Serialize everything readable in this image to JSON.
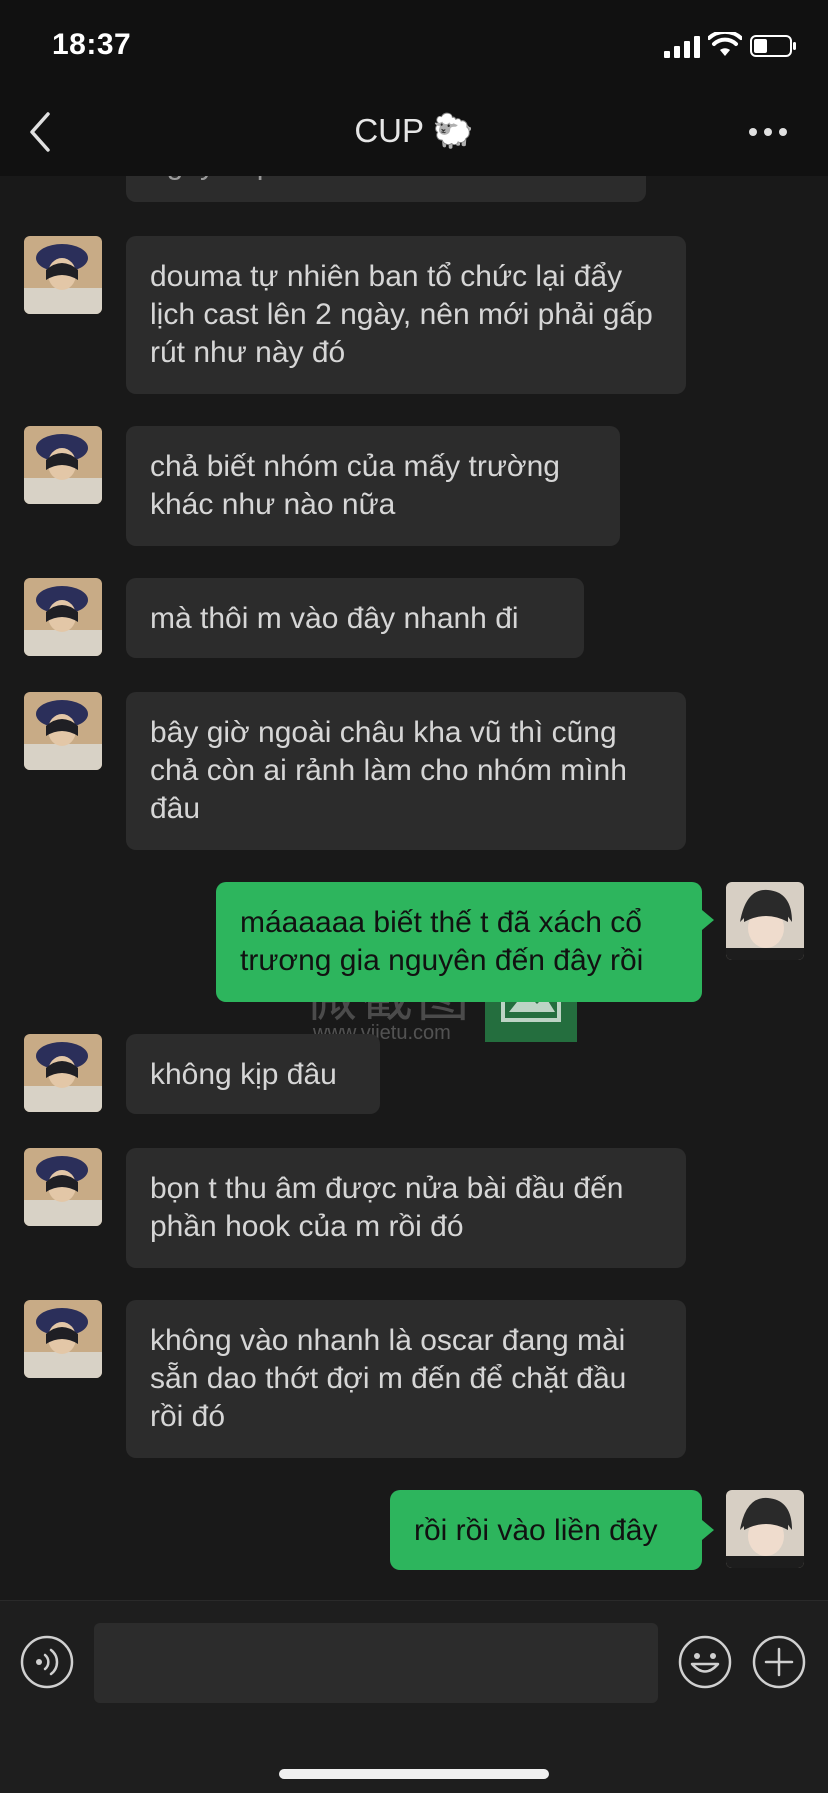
{
  "status_bar": {
    "time": "18:37"
  },
  "header": {
    "title": "CUP 🐑"
  },
  "messages": [
    {
      "from": "other",
      "text": "ngày ... p"
    },
    {
      "from": "other",
      "text": "douma tự nhiên ban tổ chức lại đẩy lịch cast lên 2 ngày, nên mới phải gấp rút như này đó"
    },
    {
      "from": "other",
      "text": "chả biết nhóm của mấy trường khác như nào nữa"
    },
    {
      "from": "other",
      "text": "mà thôi m vào đây nhanh đi"
    },
    {
      "from": "other",
      "text": "bây giờ ngoài châu kha vũ thì cũng chả còn ai rảnh làm cho nhóm mình đâu"
    },
    {
      "from": "me",
      "text": "máaaaaa biết thế t đã xách cổ trương gia nguyên đến đây rồi"
    },
    {
      "from": "other",
      "text": "không kịp đâu"
    },
    {
      "from": "other",
      "text": "bọn t thu âm được nửa bài đầu đến phần hook của m rồi đó"
    },
    {
      "from": "other",
      "text": "không vào nhanh là oscar đang mài sẵn dao thớt đợi m đến để chặt đầu rồi đó"
    },
    {
      "from": "me",
      "text": "rồi rồi vào liền đây"
    }
  ],
  "watermark": {
    "text": "微截图",
    "url": "www.vjietu.com"
  },
  "input_bar": {
    "value": "",
    "placeholder": ""
  },
  "icons": {
    "back": "chevron-left-icon",
    "more": "more-dots-icon",
    "voice": "voice-icon",
    "emoji": "emoji-icon",
    "plus": "plus-icon"
  },
  "colors": {
    "background": "#191919",
    "incoming_bubble": "#2c2c2c",
    "outgoing_bubble": "#2db55d"
  }
}
